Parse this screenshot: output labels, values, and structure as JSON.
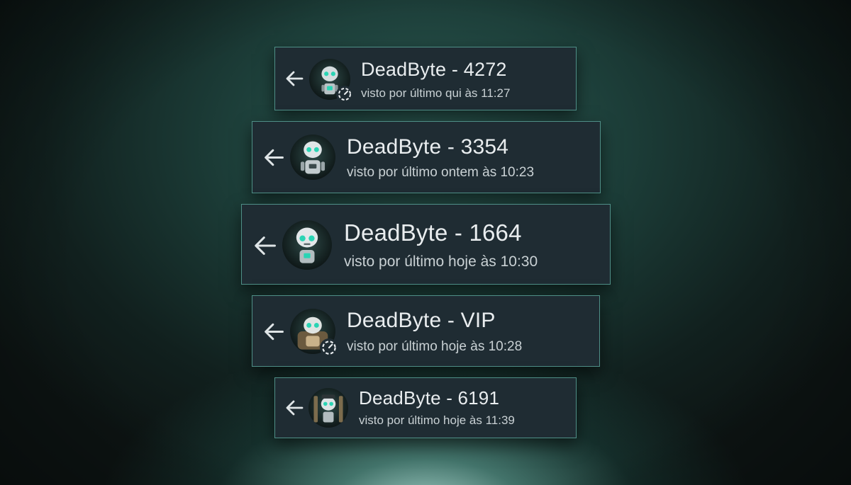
{
  "chats": [
    {
      "name": "DeadByte - 4272",
      "last_seen": "visto por último qui às 11:27",
      "avatar_icon": "robot-avatar-icon",
      "has_status": true
    },
    {
      "name": "DeadByte - 3354",
      "last_seen": "visto por último ontem às 10:23",
      "avatar_icon": "robot-avatar-icon",
      "has_status": false
    },
    {
      "name": "DeadByte - 1664",
      "last_seen": "visto por último hoje às 10:30",
      "avatar_icon": "robot-avatar-icon",
      "has_status": false
    },
    {
      "name": "DeadByte - VIP",
      "last_seen": "visto por último hoje às 10:28",
      "avatar_icon": "robot-avatar-icon",
      "has_status": true
    },
    {
      "name": "DeadByte - 6191",
      "last_seen": "visto por último hoje às 11:39",
      "avatar_icon": "robot-avatar-icon",
      "has_status": false
    }
  ],
  "colors": {
    "card_bg": "#1f2c33",
    "card_border": "#4f8f87",
    "accent_teal": "#2ad4b4",
    "text_primary": "#e9edef",
    "text_secondary": "#c9d1d4"
  }
}
